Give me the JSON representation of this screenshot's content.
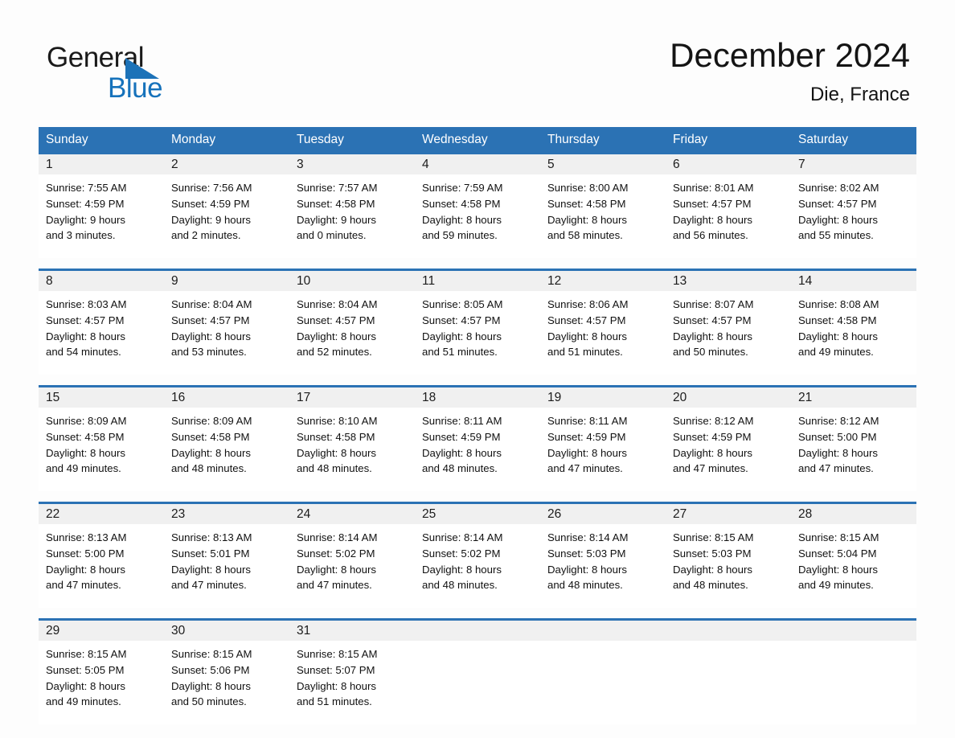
{
  "brand": {
    "word1": "General",
    "word2": "Blue",
    "triangle_color": "#1c72b8",
    "blue_color": "#1672bb"
  },
  "header": {
    "title": "December 2024",
    "location": "Die, France"
  },
  "theme": {
    "header_blue": "#2b72b4",
    "date_band": "#f0f0f0",
    "page_background": "#fdfdfd"
  },
  "weekdays": [
    "Sunday",
    "Monday",
    "Tuesday",
    "Wednesday",
    "Thursday",
    "Friday",
    "Saturday"
  ],
  "weeks": [
    {
      "days": [
        {
          "date": "1",
          "sunrise": "Sunrise: 7:55 AM",
          "sunset": "Sunset: 4:59 PM",
          "daylight1": "Daylight: 9 hours",
          "daylight2": "and 3 minutes."
        },
        {
          "date": "2",
          "sunrise": "Sunrise: 7:56 AM",
          "sunset": "Sunset: 4:59 PM",
          "daylight1": "Daylight: 9 hours",
          "daylight2": "and 2 minutes."
        },
        {
          "date": "3",
          "sunrise": "Sunrise: 7:57 AM",
          "sunset": "Sunset: 4:58 PM",
          "daylight1": "Daylight: 9 hours",
          "daylight2": "and 0 minutes."
        },
        {
          "date": "4",
          "sunrise": "Sunrise: 7:59 AM",
          "sunset": "Sunset: 4:58 PM",
          "daylight1": "Daylight: 8 hours",
          "daylight2": "and 59 minutes."
        },
        {
          "date": "5",
          "sunrise": "Sunrise: 8:00 AM",
          "sunset": "Sunset: 4:58 PM",
          "daylight1": "Daylight: 8 hours",
          "daylight2": "and 58 minutes."
        },
        {
          "date": "6",
          "sunrise": "Sunrise: 8:01 AM",
          "sunset": "Sunset: 4:57 PM",
          "daylight1": "Daylight: 8 hours",
          "daylight2": "and 56 minutes."
        },
        {
          "date": "7",
          "sunrise": "Sunrise: 8:02 AM",
          "sunset": "Sunset: 4:57 PM",
          "daylight1": "Daylight: 8 hours",
          "daylight2": "and 55 minutes."
        }
      ]
    },
    {
      "days": [
        {
          "date": "8",
          "sunrise": "Sunrise: 8:03 AM",
          "sunset": "Sunset: 4:57 PM",
          "daylight1": "Daylight: 8 hours",
          "daylight2": "and 54 minutes."
        },
        {
          "date": "9",
          "sunrise": "Sunrise: 8:04 AM",
          "sunset": "Sunset: 4:57 PM",
          "daylight1": "Daylight: 8 hours",
          "daylight2": "and 53 minutes."
        },
        {
          "date": "10",
          "sunrise": "Sunrise: 8:04 AM",
          "sunset": "Sunset: 4:57 PM",
          "daylight1": "Daylight: 8 hours",
          "daylight2": "and 52 minutes."
        },
        {
          "date": "11",
          "sunrise": "Sunrise: 8:05 AM",
          "sunset": "Sunset: 4:57 PM",
          "daylight1": "Daylight: 8 hours",
          "daylight2": "and 51 minutes."
        },
        {
          "date": "12",
          "sunrise": "Sunrise: 8:06 AM",
          "sunset": "Sunset: 4:57 PM",
          "daylight1": "Daylight: 8 hours",
          "daylight2": "and 51 minutes."
        },
        {
          "date": "13",
          "sunrise": "Sunrise: 8:07 AM",
          "sunset": "Sunset: 4:57 PM",
          "daylight1": "Daylight: 8 hours",
          "daylight2": "and 50 minutes."
        },
        {
          "date": "14",
          "sunrise": "Sunrise: 8:08 AM",
          "sunset": "Sunset: 4:58 PM",
          "daylight1": "Daylight: 8 hours",
          "daylight2": "and 49 minutes."
        }
      ]
    },
    {
      "days": [
        {
          "date": "15",
          "sunrise": "Sunrise: 8:09 AM",
          "sunset": "Sunset: 4:58 PM",
          "daylight1": "Daylight: 8 hours",
          "daylight2": "and 49 minutes."
        },
        {
          "date": "16",
          "sunrise": "Sunrise: 8:09 AM",
          "sunset": "Sunset: 4:58 PM",
          "daylight1": "Daylight: 8 hours",
          "daylight2": "and 48 minutes."
        },
        {
          "date": "17",
          "sunrise": "Sunrise: 8:10 AM",
          "sunset": "Sunset: 4:58 PM",
          "daylight1": "Daylight: 8 hours",
          "daylight2": "and 48 minutes."
        },
        {
          "date": "18",
          "sunrise": "Sunrise: 8:11 AM",
          "sunset": "Sunset: 4:59 PM",
          "daylight1": "Daylight: 8 hours",
          "daylight2": "and 48 minutes."
        },
        {
          "date": "19",
          "sunrise": "Sunrise: 8:11 AM",
          "sunset": "Sunset: 4:59 PM",
          "daylight1": "Daylight: 8 hours",
          "daylight2": "and 47 minutes."
        },
        {
          "date": "20",
          "sunrise": "Sunrise: 8:12 AM",
          "sunset": "Sunset: 4:59 PM",
          "daylight1": "Daylight: 8 hours",
          "daylight2": "and 47 minutes."
        },
        {
          "date": "21",
          "sunrise": "Sunrise: 8:12 AM",
          "sunset": "Sunset: 5:00 PM",
          "daylight1": "Daylight: 8 hours",
          "daylight2": "and 47 minutes."
        }
      ]
    },
    {
      "days": [
        {
          "date": "22",
          "sunrise": "Sunrise: 8:13 AM",
          "sunset": "Sunset: 5:00 PM",
          "daylight1": "Daylight: 8 hours",
          "daylight2": "and 47 minutes."
        },
        {
          "date": "23",
          "sunrise": "Sunrise: 8:13 AM",
          "sunset": "Sunset: 5:01 PM",
          "daylight1": "Daylight: 8 hours",
          "daylight2": "and 47 minutes."
        },
        {
          "date": "24",
          "sunrise": "Sunrise: 8:14 AM",
          "sunset": "Sunset: 5:02 PM",
          "daylight1": "Daylight: 8 hours",
          "daylight2": "and 47 minutes."
        },
        {
          "date": "25",
          "sunrise": "Sunrise: 8:14 AM",
          "sunset": "Sunset: 5:02 PM",
          "daylight1": "Daylight: 8 hours",
          "daylight2": "and 48 minutes."
        },
        {
          "date": "26",
          "sunrise": "Sunrise: 8:14 AM",
          "sunset": "Sunset: 5:03 PM",
          "daylight1": "Daylight: 8 hours",
          "daylight2": "and 48 minutes."
        },
        {
          "date": "27",
          "sunrise": "Sunrise: 8:15 AM",
          "sunset": "Sunset: 5:03 PM",
          "daylight1": "Daylight: 8 hours",
          "daylight2": "and 48 minutes."
        },
        {
          "date": "28",
          "sunrise": "Sunrise: 8:15 AM",
          "sunset": "Sunset: 5:04 PM",
          "daylight1": "Daylight: 8 hours",
          "daylight2": "and 49 minutes."
        }
      ]
    },
    {
      "days": [
        {
          "date": "29",
          "sunrise": "Sunrise: 8:15 AM",
          "sunset": "Sunset: 5:05 PM",
          "daylight1": "Daylight: 8 hours",
          "daylight2": "and 49 minutes."
        },
        {
          "date": "30",
          "sunrise": "Sunrise: 8:15 AM",
          "sunset": "Sunset: 5:06 PM",
          "daylight1": "Daylight: 8 hours",
          "daylight2": "and 50 minutes."
        },
        {
          "date": "31",
          "sunrise": "Sunrise: 8:15 AM",
          "sunset": "Sunset: 5:07 PM",
          "daylight1": "Daylight: 8 hours",
          "daylight2": "and 51 minutes."
        },
        {
          "date": "",
          "sunrise": "",
          "sunset": "",
          "daylight1": "",
          "daylight2": ""
        },
        {
          "date": "",
          "sunrise": "",
          "sunset": "",
          "daylight1": "",
          "daylight2": ""
        },
        {
          "date": "",
          "sunrise": "",
          "sunset": "",
          "daylight1": "",
          "daylight2": ""
        },
        {
          "date": "",
          "sunrise": "",
          "sunset": "",
          "daylight1": "",
          "daylight2": ""
        }
      ]
    }
  ]
}
